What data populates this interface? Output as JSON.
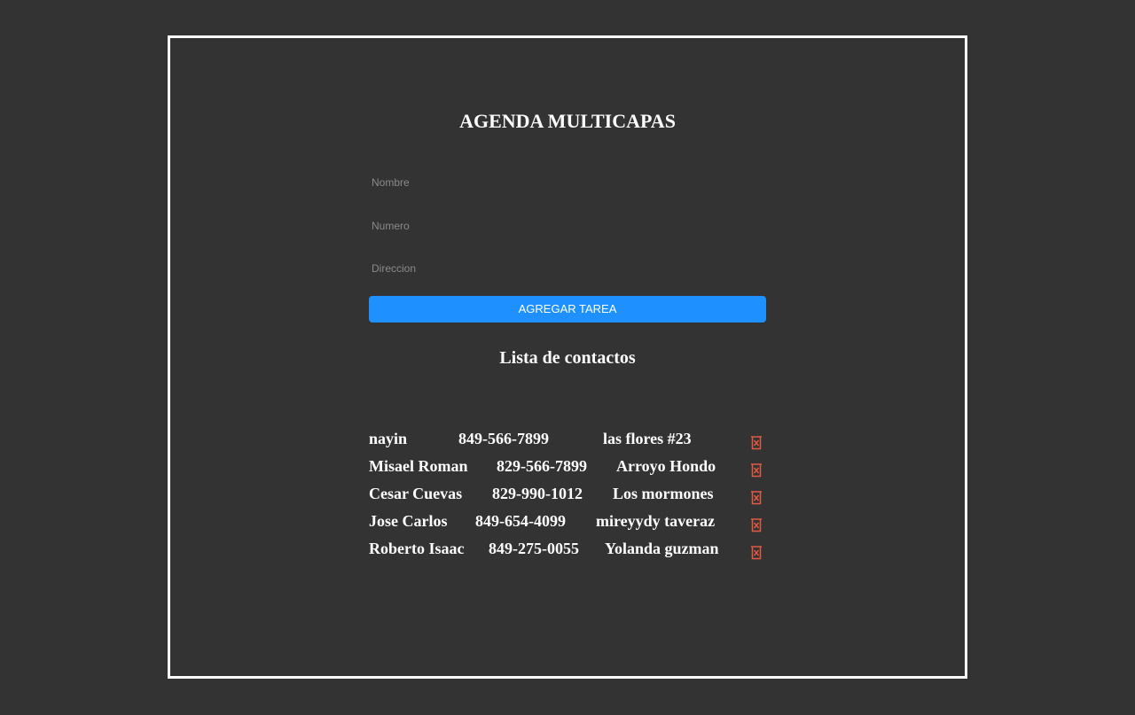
{
  "app": {
    "title": "AGENDA MULTICAPAS"
  },
  "form": {
    "name_placeholder": "Nombre",
    "number_placeholder": "Numero",
    "address_placeholder": "Direccion",
    "add_button_label": "AGREGAR TAREA"
  },
  "list": {
    "title": "Lista de contactos",
    "delete_icon": "trash-icon",
    "delete_icon_color": "#e05a45",
    "contacts": [
      {
        "name": "nayin",
        "number": "849-566-7899",
        "address": "las flores #23"
      },
      {
        "name": "Misael Roman",
        "number": "829-566-7899",
        "address": "Arroyo Hondo"
      },
      {
        "name": "Cesar Cuevas",
        "number": "829-990-1012",
        "address": "Los mormones"
      },
      {
        "name": "Jose Carlos",
        "number": "849-654-4099",
        "address": "mireyydy taveraz"
      },
      {
        "name": "Roberto Isaac",
        "number": "849-275-0055",
        "address": "Yolanda guzman"
      }
    ]
  },
  "colors": {
    "background": "#333333",
    "frame": "#ffffff",
    "button": "#1e90ff",
    "text": "#ffffff"
  }
}
